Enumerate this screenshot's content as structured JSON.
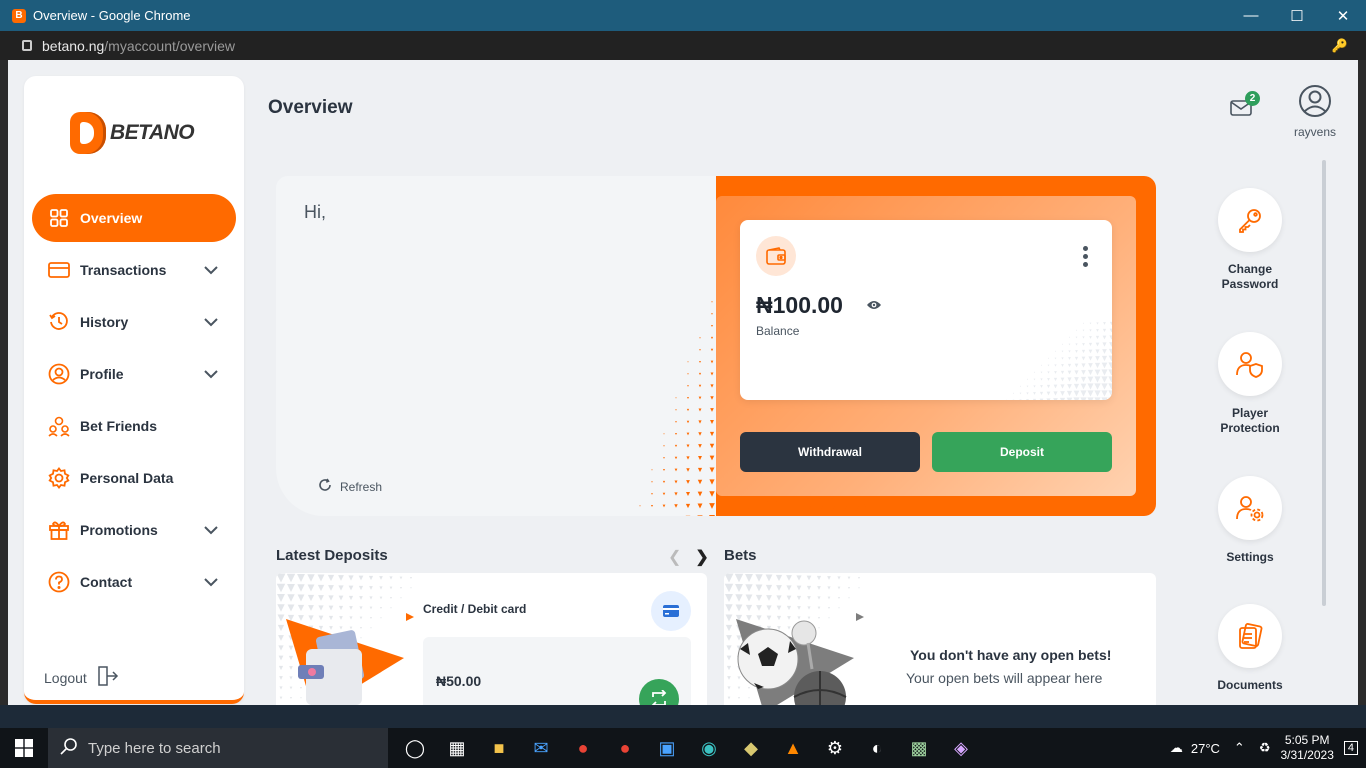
{
  "window": {
    "title": "Overview - Google Chrome",
    "url_host": "betano.ng",
    "url_path": "/myaccount/overview"
  },
  "brand": {
    "name": "BETANO",
    "accent": "#ff6a00"
  },
  "sidebar": {
    "items": [
      {
        "label": "Overview",
        "icon": "grid-icon",
        "active": true
      },
      {
        "label": "Transactions",
        "icon": "card-icon",
        "expandable": true
      },
      {
        "label": "History",
        "icon": "history-icon",
        "expandable": true
      },
      {
        "label": "Profile",
        "icon": "user-icon",
        "expandable": true
      },
      {
        "label": "Bet Friends",
        "icon": "friends-icon"
      },
      {
        "label": "Personal Data",
        "icon": "gear-icon"
      },
      {
        "label": "Promotions",
        "icon": "gift-icon",
        "expandable": true
      },
      {
        "label": "Contact",
        "icon": "help-icon",
        "expandable": true
      }
    ],
    "logout": "Logout"
  },
  "header": {
    "title": "Overview",
    "mail_count": "2",
    "username": "rayvens"
  },
  "hero": {
    "greeting": "Hi,",
    "refresh": "Refresh",
    "balance_amount": "₦100.00",
    "balance_label": "Balance",
    "withdraw": "Withdrawal",
    "deposit": "Deposit"
  },
  "quick_actions": [
    {
      "label": "Change Password",
      "icon": "key-icon"
    },
    {
      "label": "Player Protection",
      "icon": "user-shield-icon"
    },
    {
      "label": "Settings",
      "icon": "user-gear-icon"
    },
    {
      "label": "Documents",
      "icon": "documents-icon"
    }
  ],
  "latest_deposits": {
    "title": "Latest Deposits",
    "method": "Credit / Debit card",
    "amount": "₦50.00"
  },
  "bets": {
    "title": "Bets",
    "empty_title": "You don't have any open bets!",
    "empty_sub": "Your open bets will appear here"
  },
  "taskbar": {
    "search_placeholder": "Type here to search",
    "temperature": "27°C",
    "time": "5:05 PM",
    "date": "3/31/2023",
    "notifications": "4"
  }
}
